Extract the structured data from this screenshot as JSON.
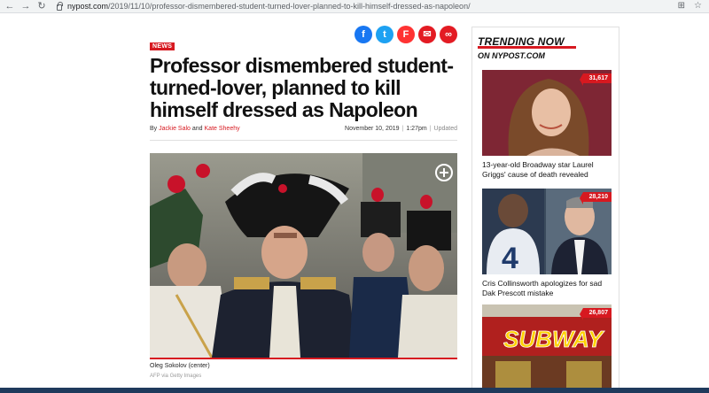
{
  "browser": {
    "url_domain": "nypost.com",
    "url_path": "/2019/11/10/professor-dismembered-student-turned-lover-planned-to-kill-himself-dressed-as-napoleon/",
    "back": "←",
    "forward": "→",
    "reload": "↻"
  },
  "article": {
    "section_badge": "NEWS",
    "headline": "Professor dismembered student-turned-lover, planned to kill himself dressed as Napoleon",
    "by": "By",
    "author1": "Jackie Salo",
    "and": "and",
    "author2": "Kate Sheehy",
    "date": "November 10, 2019",
    "time": "1:27pm",
    "updated": "Updated",
    "caption": "Oleg Sokolov (center)",
    "credit": "AFP via Getty Images",
    "share": [
      {
        "name": "facebook",
        "glyph": "f"
      },
      {
        "name": "twitter",
        "glyph": "t"
      },
      {
        "name": "flipboard",
        "glyph": "F"
      },
      {
        "name": "email",
        "glyph": "✉"
      },
      {
        "name": "link",
        "glyph": "∞"
      }
    ]
  },
  "sidebar": {
    "title": "TRENDING NOW",
    "subtitle": "ON NYPOST.COM",
    "items": [
      {
        "count": "31,617",
        "text": "13-year-old Broadway star Laurel Griggs' cause of death revealed"
      },
      {
        "count": "28,210",
        "text": "Cris Collinsworth apologizes for sad Dak Prescott mistake"
      },
      {
        "count": "26,807",
        "text": "",
        "sign": "SUBWAY"
      }
    ]
  },
  "colors": {
    "accent": "#d71920",
    "facebook": "#1877f2",
    "twitter": "#1da1f2"
  }
}
